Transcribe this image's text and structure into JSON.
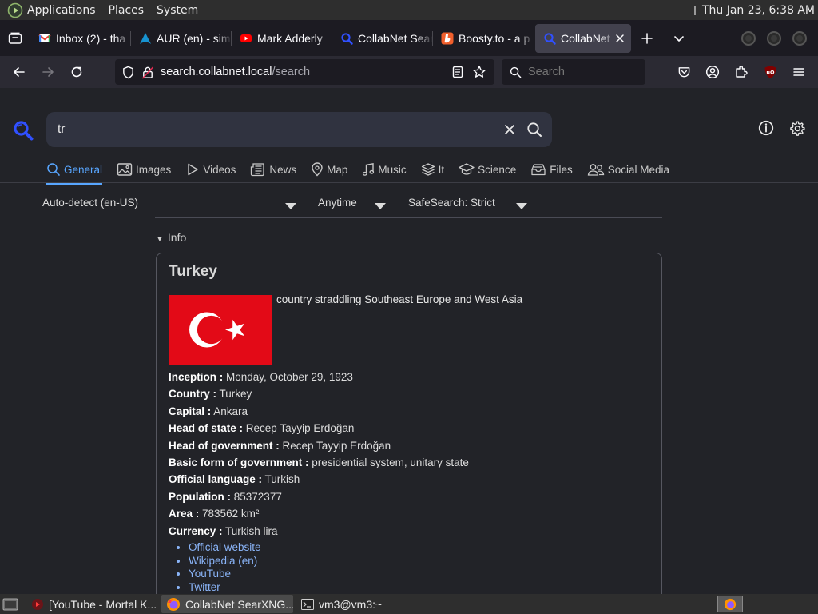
{
  "panel": {
    "menus": [
      "Applications",
      "Places",
      "System"
    ],
    "clock": "Thu Jan 23,  6:38 AM"
  },
  "tabs": [
    {
      "title": "Inbox (2) - tha",
      "icon": "gmail-icon"
    },
    {
      "title": "AUR (en) - sim",
      "icon": "arch-icon"
    },
    {
      "title": "Mark Adderly",
      "icon": "youtube-icon"
    },
    {
      "title": "CollabNet Sear",
      "icon": "searxng-icon"
    },
    {
      "title": "Boosty.to - a p",
      "icon": "boosty-icon"
    },
    {
      "title": "CollabNet S",
      "icon": "searxng-icon",
      "active": true
    }
  ],
  "urlbar": {
    "host": "search.collabnet.local",
    "path": "/search"
  },
  "searchbar": {
    "placeholder": "Search"
  },
  "query": "tr",
  "categories": [
    {
      "label": "General",
      "icon": "search-icon",
      "active": true
    },
    {
      "label": "Images",
      "icon": "image-icon"
    },
    {
      "label": "Videos",
      "icon": "play-icon"
    },
    {
      "label": "News",
      "icon": "newspaper-icon"
    },
    {
      "label": "Map",
      "icon": "map-pin-icon"
    },
    {
      "label": "Music",
      "icon": "music-note-icon"
    },
    {
      "label": "It",
      "icon": "layers-icon"
    },
    {
      "label": "Science",
      "icon": "school-icon"
    },
    {
      "label": "Files",
      "icon": "file-tray-icon"
    },
    {
      "label": "Social Media",
      "icon": "people-icon"
    }
  ],
  "filters": {
    "language": "Auto-detect (en-US)",
    "time": "Anytime",
    "safesearch": "SafeSearch: Strict"
  },
  "info_heading": "Info",
  "infobox": {
    "title": "Turkey",
    "description": "country straddling Southeast Europe and West Asia",
    "flag_colors": {
      "red": "#e30a17",
      "white": "#ffffff"
    },
    "fields": [
      {
        "label": "Inception :",
        "value": "Monday, October 29, 1923"
      },
      {
        "label": "Country :",
        "value": "Turkey"
      },
      {
        "label": "Capital :",
        "value": "Ankara"
      },
      {
        "label": "Head of state :",
        "value": "Recep Tayyip Erdoğan"
      },
      {
        "label": "Head of government :",
        "value": "Recep Tayyip Erdoğan"
      },
      {
        "label": "Basic form of government :",
        "value": "presidential system, unitary state"
      },
      {
        "label": "Official language :",
        "value": "Turkish"
      },
      {
        "label": "Population :",
        "value": "85372377"
      },
      {
        "label": "Area :",
        "value": "783562 km²"
      },
      {
        "label": "Currency :",
        "value": "Turkish lira"
      }
    ],
    "links": [
      "Official website",
      "Wikipedia (en)",
      "YouTube",
      "Twitter"
    ]
  },
  "taskbar": [
    {
      "label": "[YouTube - Mortal K...",
      "icon": "youtube-icon"
    },
    {
      "label": "CollabNet SearXNG...",
      "icon": "firefox-icon",
      "active": true
    },
    {
      "label": "vm3@vm3:~",
      "icon": "terminal-icon"
    }
  ],
  "colors": {
    "accent": "#58a6ff",
    "link": "#8ab4f8",
    "page_bg": "#222328",
    "searx_blue": "#3050ff"
  }
}
